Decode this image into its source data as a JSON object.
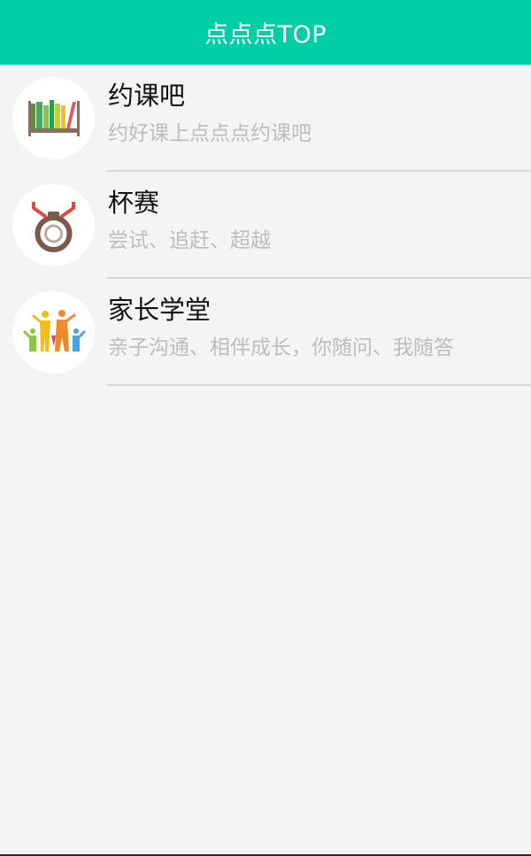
{
  "header": {
    "title": "点点点TOP",
    "color": "#00cfa6"
  },
  "list": {
    "items": [
      {
        "icon": "bookshelf-icon",
        "title": "约课吧",
        "subtitle": "约好课上点点点约课吧"
      },
      {
        "icon": "medal-icon",
        "title": "杯赛",
        "subtitle": "尝试、追赶、超越"
      },
      {
        "icon": "family-icon",
        "title": "家长学堂",
        "subtitle": "亲子沟通、相伴成长，你随问、我随答"
      }
    ]
  }
}
